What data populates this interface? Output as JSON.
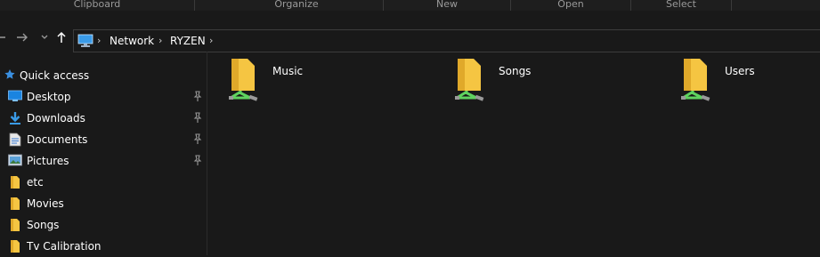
{
  "ribbon": {
    "groups": [
      "Clipboard",
      "Organize",
      "New",
      "Open",
      "Select"
    ]
  },
  "address_bar": {
    "location_icon": "computer-icon",
    "crumbs": [
      "Network",
      "RYZEN"
    ]
  },
  "nav_buttons": {
    "back_icon": "arrow-left-icon",
    "forward_icon": "arrow-right-icon",
    "recent_icon": "chevron-down-icon",
    "up_icon": "arrow-up-icon"
  },
  "nav_pane": {
    "quick_access": {
      "label": "Quick access",
      "icon": "star-icon"
    },
    "items": [
      {
        "label": "Desktop",
        "icon": "desktop-icon",
        "pinned": true
      },
      {
        "label": "Downloads",
        "icon": "download-icon",
        "pinned": true
      },
      {
        "label": "Documents",
        "icon": "document-icon",
        "pinned": true
      },
      {
        "label": "Pictures",
        "icon": "pictures-icon",
        "pinned": true
      },
      {
        "label": "etc",
        "icon": "folder-icon",
        "pinned": false
      },
      {
        "label": "Movies",
        "icon": "folder-icon",
        "pinned": false
      },
      {
        "label": "Songs",
        "icon": "folder-icon",
        "pinned": false
      },
      {
        "label": "Tv Calibration",
        "icon": "folder-icon",
        "pinned": false
      }
    ]
  },
  "content": {
    "shares": [
      {
        "name": "Music",
        "icon": "network-share-folder-icon"
      },
      {
        "name": "Songs",
        "icon": "network-share-folder-icon"
      },
      {
        "name": "Users",
        "icon": "network-share-folder-icon"
      }
    ]
  },
  "colors": {
    "background": "#191919",
    "folder": "#f5c542",
    "share_cable": "#5fd35f",
    "accent": "#0078d7"
  }
}
